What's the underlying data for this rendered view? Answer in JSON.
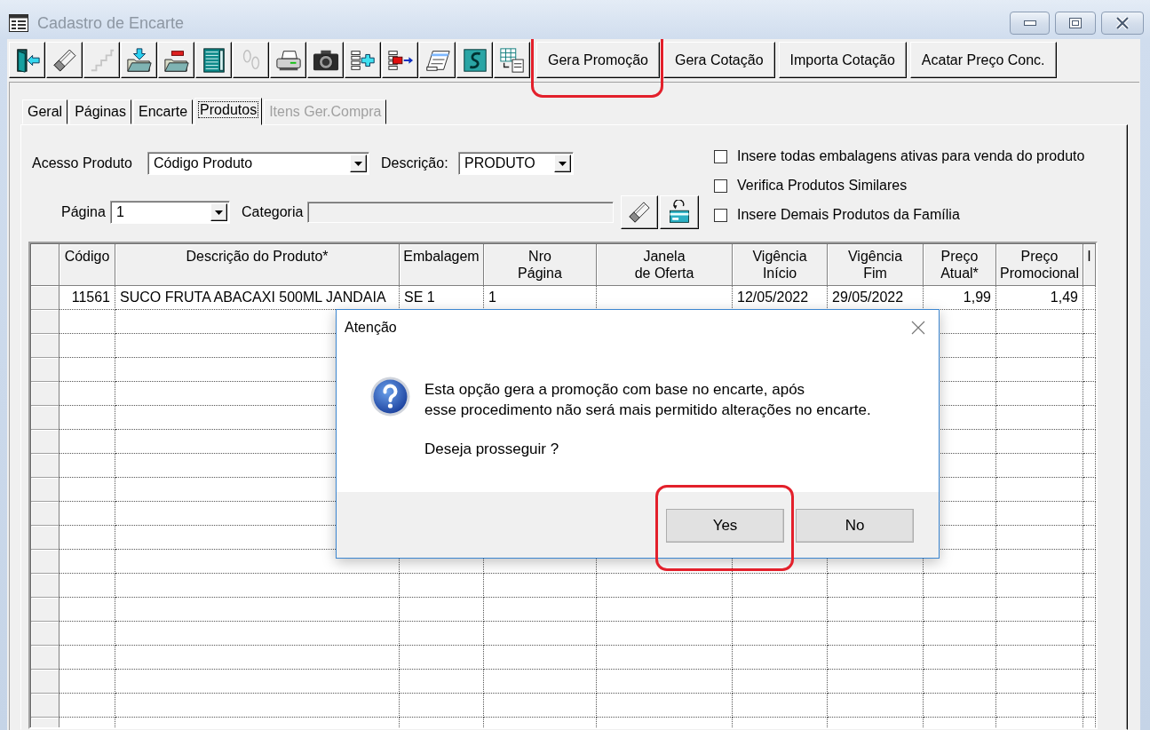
{
  "window": {
    "title": "Cadastro de Encarte",
    "active": false
  },
  "toolbar": {
    "tools": [
      {
        "kind": "exit",
        "disabled": false
      },
      {
        "kind": "eraser",
        "disabled": false
      },
      {
        "kind": "stairs",
        "disabled": true
      },
      {
        "kind": "folder-in",
        "disabled": false
      },
      {
        "kind": "folder-out",
        "disabled": false
      },
      {
        "kind": "list",
        "disabled": false
      },
      {
        "kind": "footprints",
        "disabled": true
      },
      {
        "kind": "printer",
        "disabled": false
      },
      {
        "kind": "camera",
        "disabled": false
      },
      {
        "kind": "row-add",
        "disabled": false
      },
      {
        "kind": "row-remove",
        "disabled": false
      },
      {
        "kind": "form",
        "disabled": false
      },
      {
        "kind": "s-curve",
        "disabled": false
      },
      {
        "kind": "table-export",
        "disabled": false
      }
    ],
    "buttons": [
      {
        "label": "Gera Promoção",
        "highlighted": true
      },
      {
        "label": "Gera Cotação",
        "highlighted": false
      },
      {
        "label": "Importa Cotação",
        "highlighted": false
      },
      {
        "label": "Acatar Preço Conc.",
        "highlighted": false
      }
    ]
  },
  "tabs": [
    {
      "label": "Geral",
      "selected": false,
      "disabled": false
    },
    {
      "label": "Páginas",
      "selected": false,
      "disabled": false
    },
    {
      "label": "Encarte",
      "selected": false,
      "disabled": false
    },
    {
      "label": "Produtos",
      "selected": true,
      "disabled": false
    },
    {
      "label": "Itens Ger.Compra",
      "selected": false,
      "disabled": true
    }
  ],
  "filters": {
    "acesso_produto": {
      "label": "Acesso Produto",
      "value": "Código Produto"
    },
    "descricao": {
      "label": "Descrição:",
      "value": "PRODUTO"
    },
    "pagina": {
      "label": "Página",
      "value": "1"
    },
    "categoria": {
      "label": "Categoria",
      "disabled": true
    },
    "tools": [
      {
        "kind": "eraser"
      },
      {
        "kind": "card-undo"
      }
    ]
  },
  "options": [
    {
      "label": "Insere todas embalagens ativas para venda do produto",
      "checked": false
    },
    {
      "label": "Verifica Produtos Similares",
      "checked": false
    },
    {
      "label": "Insere Demais Produtos da Família",
      "checked": false
    }
  ],
  "table": {
    "columns": [
      "Código",
      "Descrição do Produto*",
      "Embalagem",
      "Nro\nPágina",
      "Janela\nde Oferta",
      "Vigência\nInício",
      "Vigência\nFim",
      "Preço\nAtual*",
      "Preço\nPromocional",
      "I"
    ],
    "rows": [
      {
        "cells": [
          "11561",
          "SUCO FRUTA ABACAXI 500ML JANDAIA",
          "SE 1",
          "1",
          null,
          "12/05/2022",
          "29/05/2022",
          "1,99",
          "1,49"
        ]
      }
    ]
  },
  "dialog": {
    "title": "Atenção",
    "message": [
      "Esta opção gera a promoção com base no encarte, após",
      "esse procedimento não será mais permitido alterações no encarte."
    ],
    "question": "Deseja prosseguir ?",
    "buttons": [
      {
        "label": "Yes",
        "highlighted": true
      },
      {
        "label": "No",
        "highlighted": false
      }
    ]
  }
}
